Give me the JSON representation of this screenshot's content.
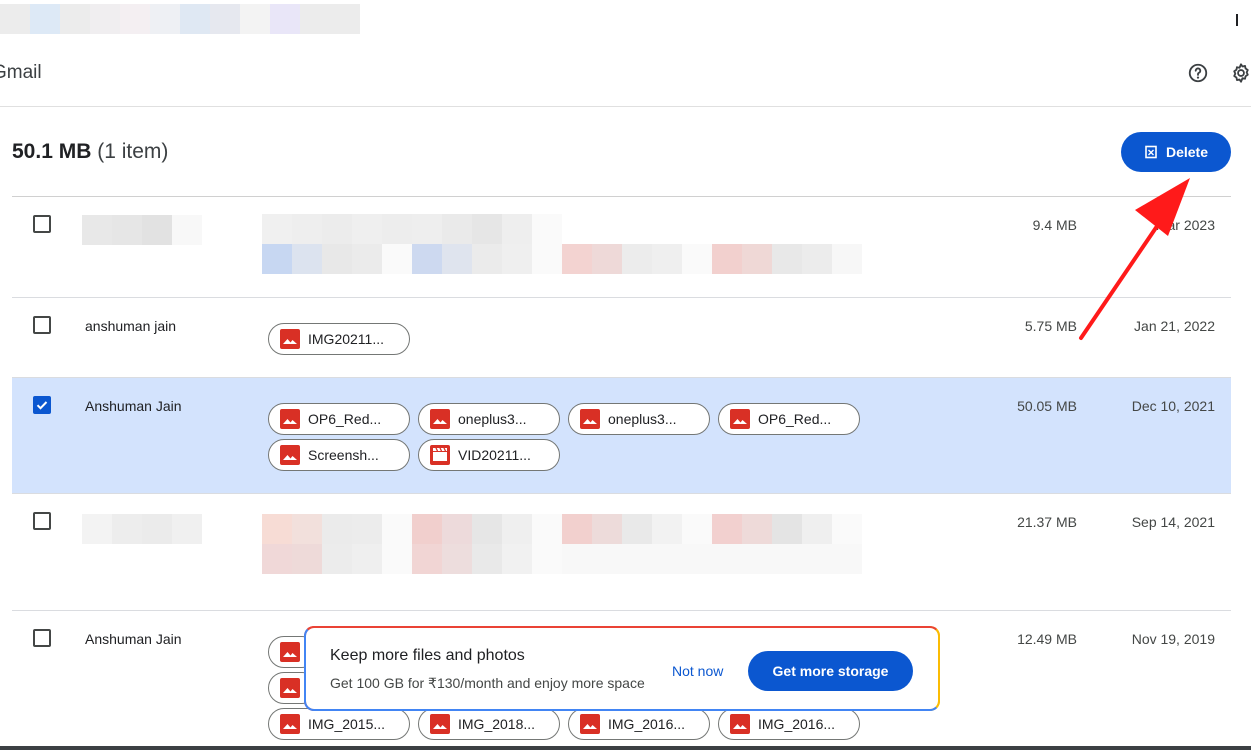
{
  "header": {
    "brand": "Gmail",
    "help_icon": "help-circle-icon",
    "settings_icon": "gear-icon"
  },
  "summary": {
    "size": "50.1 MB",
    "count": "(1 item)"
  },
  "toolbar": {
    "delete_label": "Delete",
    "delete_icon": "trash-icon"
  },
  "rows": [
    {
      "sender": "",
      "size": "9.4 MB",
      "date": "Mar 2023",
      "selected": false,
      "attachments": []
    },
    {
      "sender": "anshuman jain",
      "size": "5.75 MB",
      "date": "Jan 21, 2022",
      "selected": false,
      "attachments": [
        {
          "name": "IMG20211...",
          "icon": "image-icon"
        }
      ]
    },
    {
      "sender": "Anshuman Jain",
      "size": "50.05 MB",
      "date": "Dec 10, 2021",
      "selected": true,
      "attachments": [
        {
          "name": "OP6_Red...",
          "icon": "image-icon"
        },
        {
          "name": "oneplus3...",
          "icon": "image-icon"
        },
        {
          "name": "oneplus3...",
          "icon": "image-icon"
        },
        {
          "name": "OP6_Red...",
          "icon": "image-icon"
        },
        {
          "name": "Screensh...",
          "icon": "image-icon"
        },
        {
          "name": "VID20211...",
          "icon": "video-icon"
        }
      ]
    },
    {
      "sender": "",
      "size": "21.37 MB",
      "date": "Sep 14, 2021",
      "selected": false,
      "attachments": []
    },
    {
      "sender": "Anshuman Jain",
      "size": "12.49 MB",
      "date": "Nov 19, 2019",
      "selected": false,
      "attachments": [
        {
          "name": "IMG_2015...",
          "icon": "image-icon"
        },
        {
          "name": "IMG_2018...",
          "icon": "image-icon"
        },
        {
          "name": "IMG_2016...",
          "icon": "image-icon"
        },
        {
          "name": "IMG_2016...",
          "icon": "image-icon"
        }
      ]
    }
  ],
  "promo": {
    "title": "Keep more files and photos",
    "subtitle": "Get 100 GB for ₹130/month and enjoy more space",
    "not_now": "Not now",
    "cta": "Get more storage"
  },
  "colors": {
    "accent": "#0b57d0",
    "selected_row": "#d3e3fd",
    "file_icon": "#d93025",
    "arrow": "#ff1a1a"
  }
}
